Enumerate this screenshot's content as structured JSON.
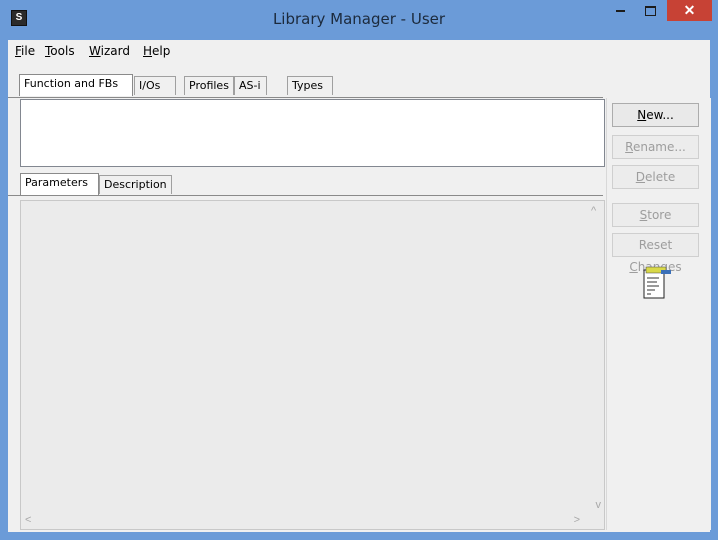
{
  "window": {
    "title": "Library Manager - User",
    "app_icon_text": "S"
  },
  "menu": [
    {
      "label": "File",
      "mnemonic": "F",
      "rest": "ile"
    },
    {
      "label": "Tools",
      "mnemonic": "T",
      "rest": "ools"
    },
    {
      "label": "Wizard",
      "mnemonic": "W",
      "rest": "izard"
    },
    {
      "label": "Help",
      "mnemonic": "H",
      "rest": "elp"
    }
  ],
  "top_tabs": [
    "Function and FBs",
    "I/Os",
    "Profiles",
    "AS-i",
    "Types"
  ],
  "bottom_tabs": [
    "Parameters",
    "Description"
  ],
  "buttons": {
    "new": {
      "pre": "",
      "mn": "N",
      "post": "ew..."
    },
    "rename": {
      "pre": "",
      "mn": "R",
      "post": "ename..."
    },
    "delete": {
      "pre": "",
      "mn": "D",
      "post": "elete"
    },
    "store": {
      "pre": "",
      "mn": "S",
      "post": "tore"
    },
    "reset": {
      "pre": "Reset ",
      "mn": "C",
      "post": "hanges"
    }
  },
  "scroll_glyphs": {
    "up": "^",
    "down": "v",
    "left": "<",
    "right": ">"
  }
}
